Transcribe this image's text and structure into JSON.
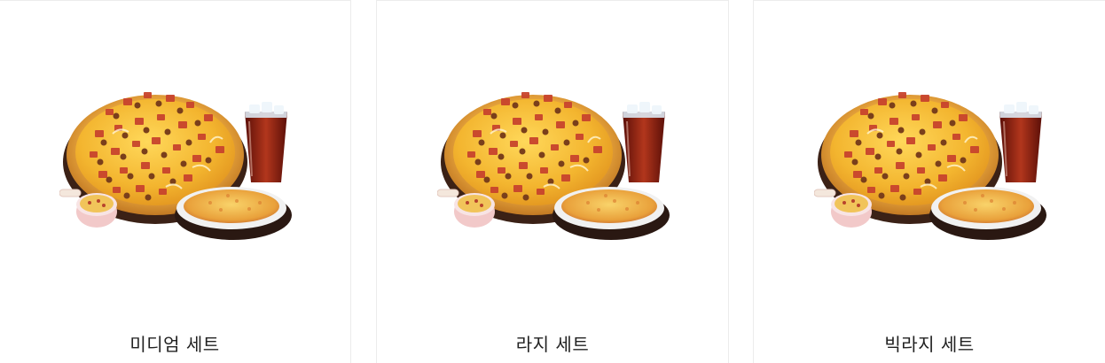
{
  "products": [
    {
      "name": "미디엄 세트",
      "image_icon": "pizza-set-image"
    },
    {
      "name": "라지 세트",
      "image_icon": "pizza-set-image"
    },
    {
      "name": "빅라지 세트",
      "image_icon": "pizza-set-image"
    }
  ],
  "colors": {
    "crust": "#d9932b",
    "cheese": "#f6c338",
    "topping": "#c3412a",
    "sausage": "#7a3f1b",
    "board": "#3b2116",
    "cola": "#8f1f12"
  }
}
